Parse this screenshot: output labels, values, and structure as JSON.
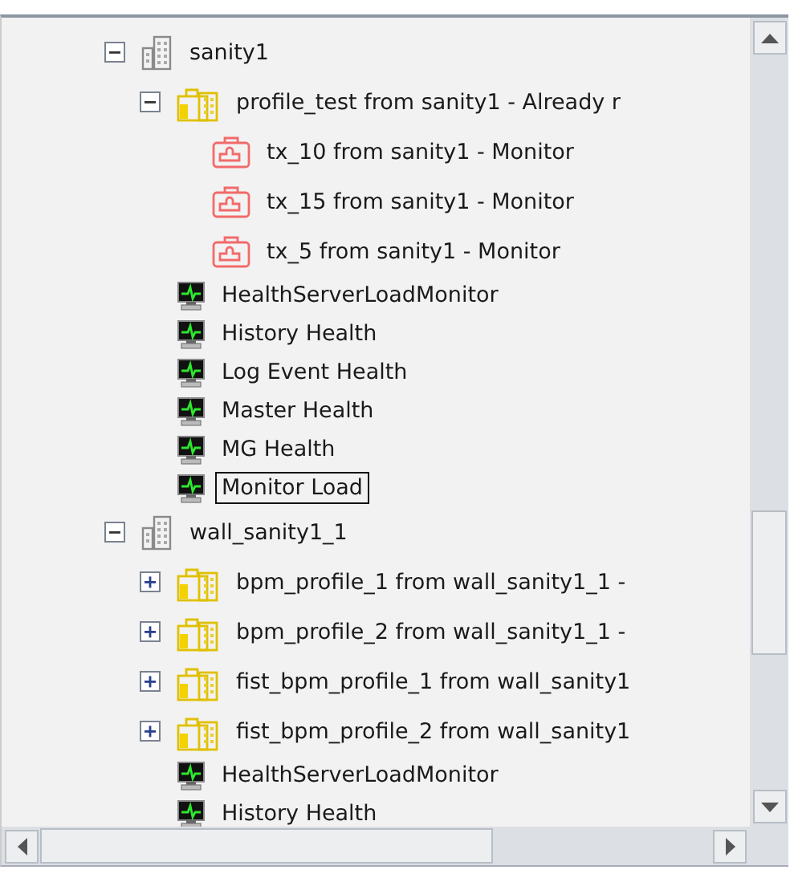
{
  "tree": [
    {
      "label": "sanity1",
      "kind": "server",
      "expanded": true,
      "selected": false,
      "children": [
        {
          "label": "profile_test from sanity1 - Already r",
          "kind": "profile",
          "expanded": true,
          "selected": false,
          "children": [
            {
              "label": "tx_10 from sanity1 - Monitor",
              "kind": "transaction",
              "selected": false
            },
            {
              "label": "tx_15 from sanity1 - Monitor",
              "kind": "transaction",
              "selected": false
            },
            {
              "label": "tx_5 from sanity1 - Monitor",
              "kind": "transaction",
              "selected": false
            }
          ]
        },
        {
          "label": "HealthServerLoadMonitor",
          "kind": "monitor",
          "selected": false
        },
        {
          "label": "History Health",
          "kind": "monitor",
          "selected": false
        },
        {
          "label": "Log Event Health",
          "kind": "monitor",
          "selected": false
        },
        {
          "label": "Master Health",
          "kind": "monitor",
          "selected": false
        },
        {
          "label": "MG Health",
          "kind": "monitor",
          "selected": false
        },
        {
          "label": "Monitor Load",
          "kind": "monitor",
          "selected": true
        }
      ]
    },
    {
      "label": "wall_sanity1_1",
      "kind": "server",
      "expanded": true,
      "selected": false,
      "children": [
        {
          "label": "bpm_profile_1 from wall_sanity1_1 -",
          "kind": "profile",
          "expanded": false,
          "selected": false
        },
        {
          "label": "bpm_profile_2 from wall_sanity1_1 -",
          "kind": "profile",
          "expanded": false,
          "selected": false
        },
        {
          "label": "fist_bpm_profile_1 from wall_sanity1",
          "kind": "profile",
          "expanded": false,
          "selected": false
        },
        {
          "label": "fist_bpm_profile_2 from wall_sanity1",
          "kind": "profile",
          "expanded": false,
          "selected": false
        },
        {
          "label": "HealthServerLoadMonitor",
          "kind": "monitor",
          "selected": false
        },
        {
          "label": "History Health",
          "kind": "monitor",
          "selected": false
        }
      ]
    }
  ]
}
